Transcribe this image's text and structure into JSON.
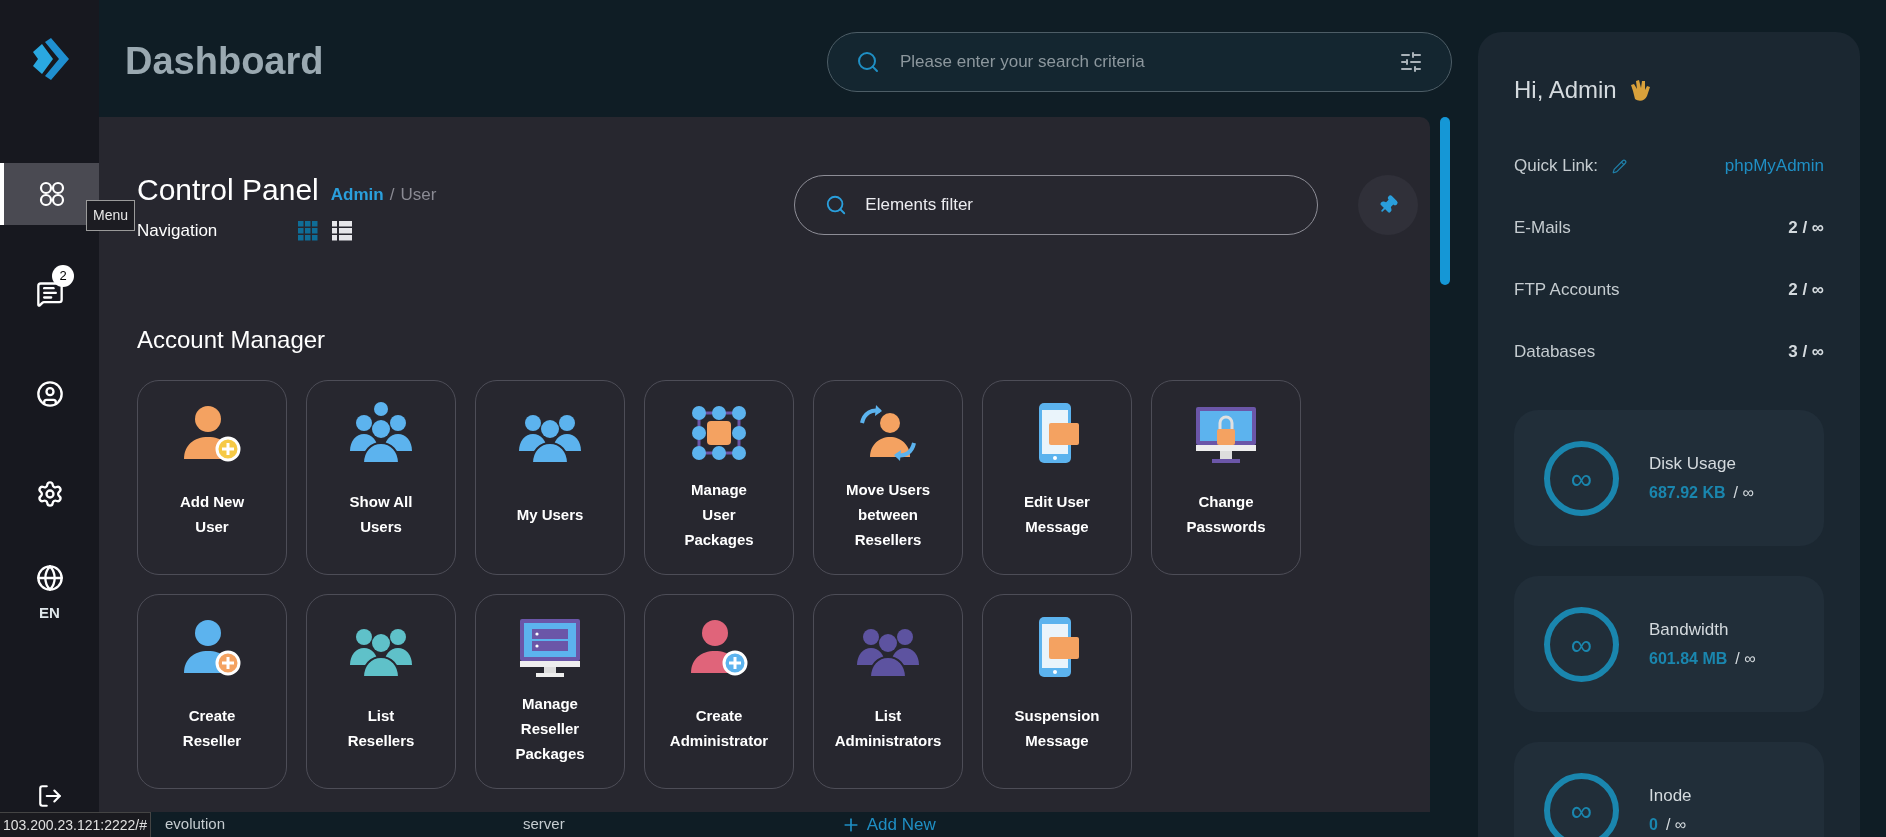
{
  "sidebar": {
    "items": [
      {
        "kind": "menu",
        "selected": true
      },
      {
        "kind": "messages",
        "selected": false,
        "badge": "2"
      },
      {
        "kind": "profile",
        "selected": false
      },
      {
        "kind": "settings",
        "selected": false
      },
      {
        "kind": "language",
        "selected": false,
        "label": "EN"
      }
    ],
    "logout": {
      "kind": "logout"
    },
    "tooltip": "Menu"
  },
  "header": {
    "title": "Dashboard",
    "search": {
      "placeholder": "Please enter your search criteria"
    }
  },
  "panel": {
    "title": "Control Panel",
    "breadcrumb": [
      "Admin",
      "User"
    ],
    "breadcrumb_separator": "/",
    "subtitle": "Navigation",
    "views": [
      {
        "kind": "grid",
        "selected": true
      },
      {
        "kind": "list",
        "selected": false
      }
    ],
    "filter": {
      "placeholder": "Elements filter"
    },
    "section": "Account Manager",
    "cards": [
      {
        "label": "Add New\nUser"
      },
      {
        "label": "Show All\nUsers"
      },
      {
        "label": "My Users"
      },
      {
        "label": "Manage\nUser\nPackages"
      },
      {
        "label": "Move Users\nbetween\nResellers"
      },
      {
        "label": "Edit User\nMessage"
      },
      {
        "label": "Change\nPasswords"
      },
      {
        "label": "Create\nReseller"
      },
      {
        "label": "List\nResellers"
      },
      {
        "label": "Manage\nReseller\nPackages"
      },
      {
        "label": "Create\nAdministrator"
      },
      {
        "label": "List\nAdministrators"
      },
      {
        "label": "Suspension\nMessage"
      }
    ]
  },
  "background_row": {
    "cells": [
      "evolution",
      "server"
    ],
    "add_button": "Add New"
  },
  "status_url": "103.200.23.121:2222/#",
  "account": {
    "greeting": "Hi, Admin",
    "quick_link": {
      "label": "Quick Link:",
      "link": "phpMyAdmin"
    },
    "limits": [
      {
        "label": "E-Mails",
        "value": "2 / ∞"
      },
      {
        "label": "FTP Accounts",
        "value": "2 / ∞"
      },
      {
        "label": "Databases",
        "value": "3 / ∞"
      }
    ],
    "usage": [
      {
        "label": "Disk Usage",
        "used": "687.92 KB",
        "limit": "/ ∞",
        "ring": "∞"
      },
      {
        "label": "Bandwidth",
        "used": "601.84 MB",
        "limit": "/ ∞",
        "ring": "∞"
      },
      {
        "label": "Inode",
        "used": "0",
        "limit": "/ ∞",
        "ring": "∞"
      }
    ]
  }
}
